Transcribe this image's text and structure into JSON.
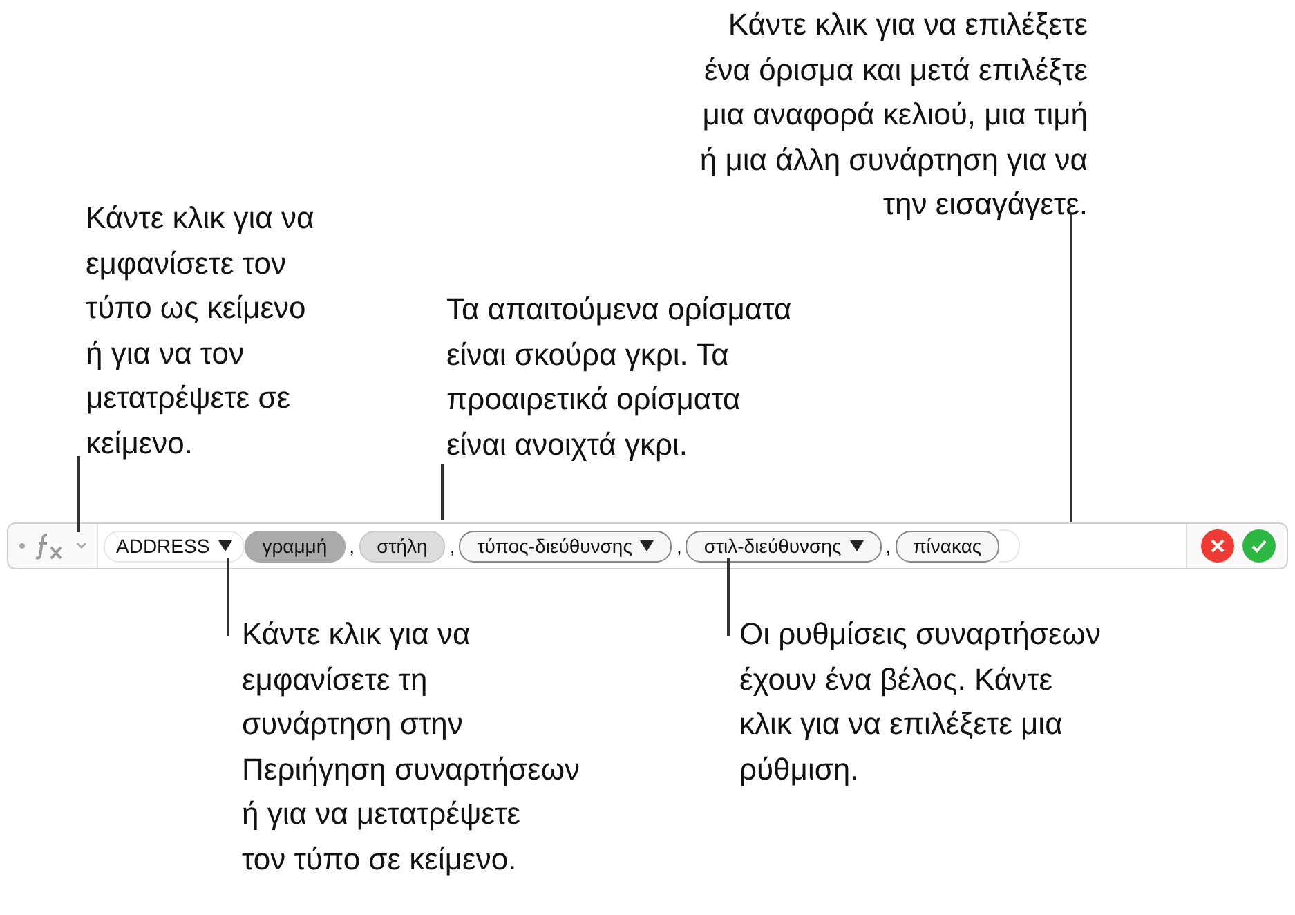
{
  "formula_bar": {
    "function": {
      "name": "ADDRESS",
      "has_menu": true
    },
    "arguments": [
      {
        "label": "γραμμή",
        "kind": "required",
        "selected": true,
        "has_menu": false
      },
      {
        "label": "στήλη",
        "kind": "required",
        "selected": false,
        "has_menu": false
      },
      {
        "label": "τύπος-διεύθυνσης",
        "kind": "optional",
        "selected": false,
        "has_menu": true
      },
      {
        "label": "στιλ-διεύθυνσης",
        "kind": "optional",
        "selected": false,
        "has_menu": true
      },
      {
        "label": "πίνακας",
        "kind": "optional",
        "selected": false,
        "has_menu": false
      }
    ],
    "separator": ","
  },
  "callouts": [
    {
      "lines": [
        "Κάντε κλικ για να",
        "εμφανίσετε τον",
        "τύπο ως κείμενο",
        "ή για να τον",
        "μετατρέψετε σε",
        "κείμενο."
      ]
    },
    {
      "lines": [
        "Τα απαιτούμενα ορίσματα",
        "είναι σκούρα γκρι. Τα",
        "προαιρετικά ορίσματα",
        "είναι ανοιχτά γκρι."
      ]
    },
    {
      "lines": [
        "Κάντε κλικ για να επιλέξετε",
        "ένα όρισμα και μετά επιλέξτε",
        "μια αναφορά κελιού, μια τιμή",
        "ή μια άλλη συνάρτηση για να",
        "την εισαγάγετε."
      ]
    },
    {
      "lines": [
        "Κάντε κλικ για να",
        "εμφανίσετε τη",
        "συνάρτηση στην",
        "Περιήγηση συναρτήσεων",
        "ή για να μετατρέψετε",
        "τον τύπο σε κείμενο."
      ]
    },
    {
      "lines": [
        "Οι ρυθμίσεις συναρτήσεων",
        "έχουν ένα βέλος. Κάντε",
        "κλικ για να επιλέξετε μια",
        "ρύθμιση."
      ]
    }
  ]
}
